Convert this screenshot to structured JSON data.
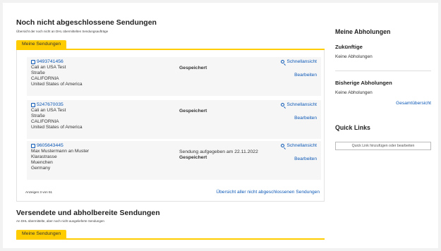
{
  "main": {
    "title": "Noch nicht abgeschlossene Sendungen",
    "subtitle": "Übersicht der noch nicht an DHL übermittelten Sendungsaufträge",
    "tab_label": "Meine Sendungen",
    "rows": [
      {
        "id": "9493741456",
        "lines": [
          "Cali an USA Test",
          "Straße",
          "CALIFORNIA",
          "United States of America"
        ],
        "status_lines": [
          "Gespeichert"
        ],
        "quick_label": "Schnellansicht",
        "edit_label": "Bearbeiten"
      },
      {
        "id": "5247670035",
        "lines": [
          "Cali an USA Test",
          "Straße",
          "CALIFORNIA",
          "United States of America"
        ],
        "status_lines": [
          "Gespeichert"
        ],
        "quick_label": "Schnellansicht",
        "edit_label": "Bearbeiten"
      },
      {
        "id": "9605643445",
        "lines": [
          "Max Mustermann an Muster",
          "Klarastrasse",
          "Muenchen",
          "Germany"
        ],
        "status_lines": [
          "Sendung aufgegeben am 22.11.2022",
          "Gespeichert"
        ],
        "quick_label": "Schnellansicht",
        "edit_label": "Bearbeiten"
      }
    ],
    "count_text": "Anzeigen 3 von 51",
    "all_link": "Übersicht aller nicht abgeschlossenen Sendungen"
  },
  "sent": {
    "title": "Versendete und abholbereite Sendungen",
    "subtitle": "An DHL übermittelte, aber noch nicht ausgelieferte Sendungen",
    "tab_label": "Meine Sendungen"
  },
  "sidebar": {
    "title": "Meine Abholungen",
    "future_heading": "Zukünftige",
    "future_text": "Keine Abholungen",
    "past_heading": "Bisherige Abholungen",
    "past_text": "Keine Abholungen",
    "overview_link": "Gesamtübersicht",
    "quick_links_heading": "Quick Links",
    "quick_links_button": "Quick Link hinzufügen oder bearbeiten"
  },
  "colors": {
    "accent_yellow": "#ffcc00",
    "link_blue": "#0c58b6",
    "row_background": "#f6f6f6"
  }
}
